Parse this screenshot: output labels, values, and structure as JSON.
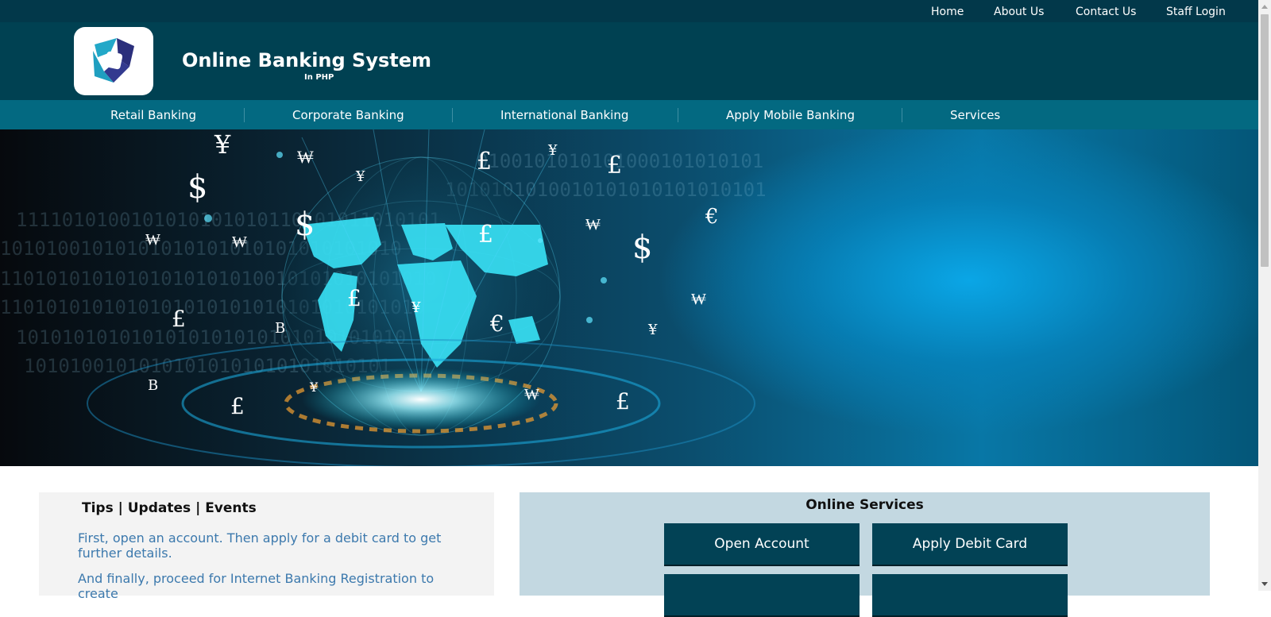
{
  "topnav": {
    "items": [
      "Home",
      "About Us",
      "Contact Us",
      "Staff Login"
    ]
  },
  "header": {
    "title": "Online Banking System",
    "subtitle": "In PHP"
  },
  "mainnav": {
    "items": [
      "Retail Banking",
      "Corporate Banking",
      "International Banking",
      "Apply Mobile Banking",
      "Services"
    ]
  },
  "hero": {
    "image": "globe-currency-banner",
    "symbols": [
      "¥",
      "₩",
      "$",
      "£",
      "¥",
      "€",
      "₩",
      "$",
      "₩",
      "¥",
      "£",
      "₩",
      "£",
      "$",
      "€",
      "₩",
      "¥",
      "£",
      "B",
      "B",
      "£",
      "₩",
      "£",
      "¥",
      "¥",
      "£"
    ]
  },
  "tips": {
    "title": "Tips | Updates | Events",
    "paragraphs": [
      "First, open an account. Then apply for a debit card to get further details.",
      "And finally, proceed for Internet Banking Registration to create"
    ]
  },
  "services": {
    "title": "Online Services",
    "buttons": [
      "Open Account",
      "Apply Debit Card",
      "",
      ""
    ]
  },
  "colors": {
    "topbar": "#02384a",
    "header": "#004152",
    "nav": "#036981",
    "button": "#024255",
    "services_panel": "#c3d8e1",
    "tips_text": "#3c79ad"
  }
}
